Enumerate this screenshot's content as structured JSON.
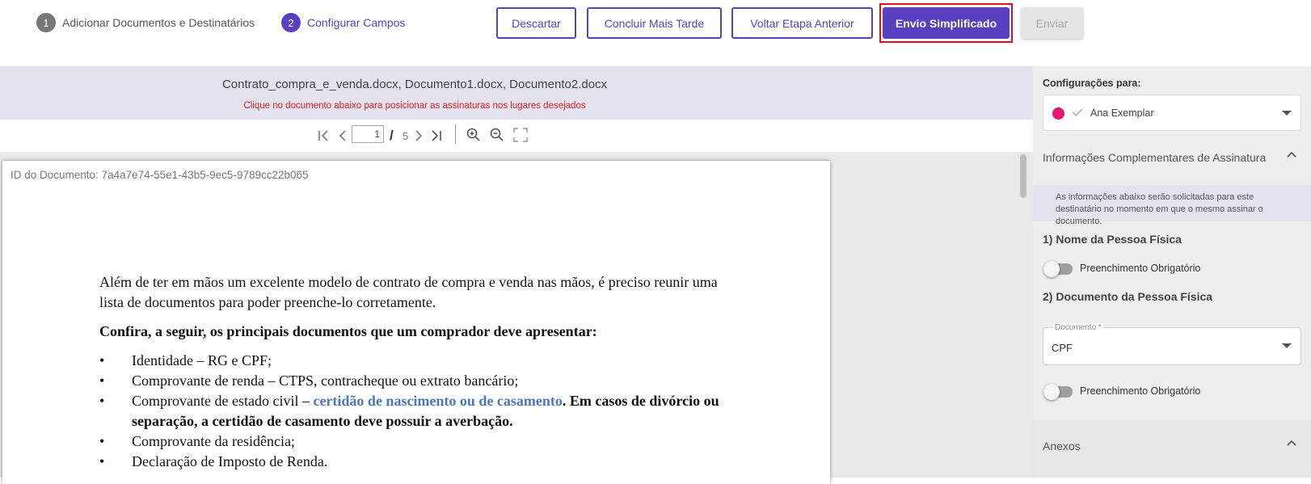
{
  "steps": [
    {
      "number": "1",
      "label": "Adicionar Documentos e Destinatários"
    },
    {
      "number": "2",
      "label": "Configurar Campos"
    }
  ],
  "actions": {
    "discard": "Descartar",
    "finish_later": "Concluir Mais Tarde",
    "previous_step": "Voltar Etapa Anterior",
    "simplified_send": "Envio Simplificado",
    "send": "Enviar"
  },
  "document": {
    "files_title": "Contrato_compra_e_venda.docx, Documento1.docx, Documento2.docx",
    "hint": "Clique no documento abaixo para posicionar as assinaturas nos lugares desejados",
    "page_current": "1",
    "page_separator": "/",
    "page_total": "5",
    "doc_id": "ID do Documento: 7a4a7e74-55e1-43b5-9ec5-9789cc22b065",
    "paragraph1": "Além de ter em mãos um excelente modelo de contrato de compra e venda nas mãos, é preciso reunir uma lista de documentos para poder preenche-lo corretamente.",
    "paragraph2": "Confira, a seguir, os principais documentos que um comprador deve apresentar:",
    "list": {
      "item1": "Identidade – RG e CPF;",
      "item2": "Comprovante de renda – CTPS, contracheque ou extrato bancário;",
      "item3_prefix": "Comprovante de estado civil – ",
      "item3_link": "certidão de nascimento ou de casamento",
      "item3_suffix": ". Em casos de divórcio ou separação, a certidão de casamento deve possuir a averbação.",
      "item4": "Comprovante da residência;",
      "item5": "Declaração de Imposto de Renda."
    }
  },
  "sidebar": {
    "config_label": "Configurações para:",
    "signer_name": "Ana Exemplar",
    "signer_color": "#e8176e",
    "section_complementary": "Informações Complementares de Assinatura",
    "info_text": "As informações abaixo serão solicitadas para este destinatário no momento em que o mesmo assinar o documento.",
    "field1_title": "1) Nome da Pessoa Física",
    "field1_toggle_label": "Preenchimento Obrigatório",
    "field2_title": "2) Documento da Pessoa Física",
    "field2_select_label": "Documento *",
    "field2_select_value": "CPF",
    "field2_toggle_label": "Preenchimento Obrigatório",
    "section_attachments": "Anexos"
  },
  "colors": {
    "accent": "#5a3fc0",
    "highlight": "#e0101a",
    "hint": "#e02020",
    "link": "#4a78c0"
  },
  "icons": [
    "first-page-icon",
    "prev-page-icon",
    "next-page-icon",
    "last-page-icon",
    "zoom-in-icon",
    "zoom-out-icon",
    "fullscreen-icon",
    "check-icon",
    "chevron-down-icon",
    "chevron-up-icon"
  ]
}
